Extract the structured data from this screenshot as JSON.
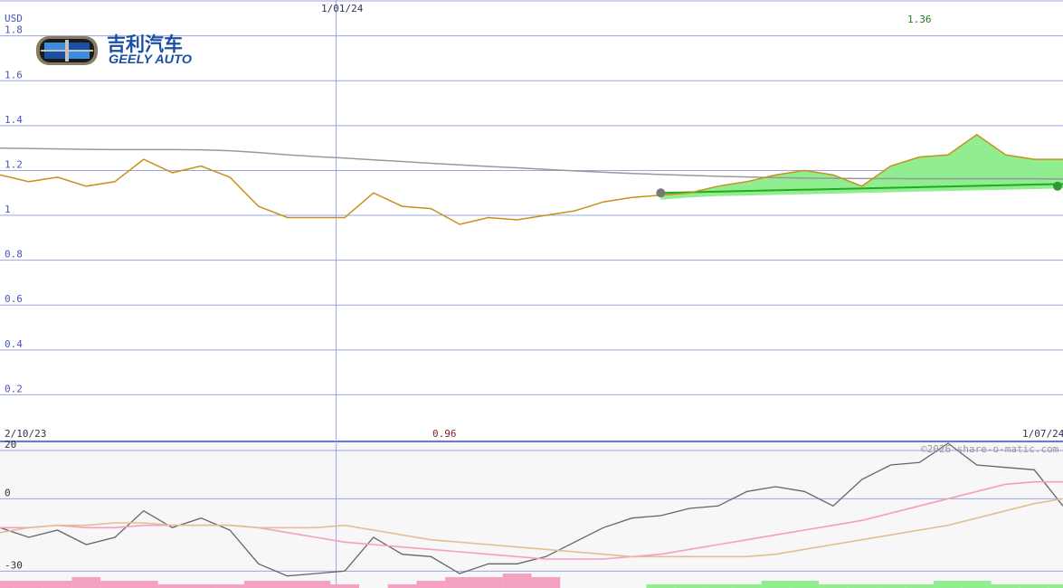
{
  "logo": {
    "cn": "吉利汽车",
    "en": "GEELY AUTO"
  },
  "watermark": "©2026 share-o-matic.com",
  "chart_data": [
    {
      "type": "line",
      "title": "",
      "ylabel": "USD",
      "y_ticks": [
        "1.8",
        "1.6",
        "1.4",
        "1.2",
        "1",
        "0.8",
        "0.6",
        "0.4",
        "0.2"
      ],
      "y_tick_values": [
        1.8,
        1.6,
        1.4,
        1.2,
        1.0,
        0.8,
        0.6,
        0.4,
        0.2
      ],
      "ylim": [
        0.0,
        1.96
      ],
      "x_start_label": "2/10/23",
      "x_end_label": "1/07/24",
      "x_marker_label": "1/01/24",
      "max_label": "1.36",
      "min_label": "0.96",
      "grid": true,
      "x_index": [
        0,
        1,
        2,
        3,
        4,
        5,
        6,
        7,
        8,
        9,
        10,
        11,
        12,
        13,
        14,
        15,
        16,
        17,
        18,
        19,
        20,
        21,
        22,
        23,
        24,
        25,
        26,
        27,
        28,
        29,
        30,
        31,
        32,
        33,
        34,
        35,
        36,
        37
      ],
      "series": [
        {
          "role": "price",
          "color": "#c8901a",
          "values": [
            1.18,
            1.15,
            1.17,
            1.13,
            1.15,
            1.25,
            1.19,
            1.22,
            1.17,
            1.04,
            0.99,
            0.99,
            0.99,
            1.1,
            1.04,
            1.03,
            0.96,
            0.99,
            0.98,
            1.0,
            1.02,
            1.06,
            1.08,
            1.09,
            1.1,
            1.13,
            1.15,
            1.18,
            1.2,
            1.18,
            1.13,
            1.22,
            1.26,
            1.27,
            1.36,
            1.27,
            1.25,
            1.25
          ]
        },
        {
          "role": "moving-average",
          "color": "#999999",
          "values": [
            1.3,
            1.298,
            1.296,
            1.294,
            1.293,
            1.293,
            1.293,
            1.292,
            1.288,
            1.28,
            1.27,
            1.262,
            1.255,
            1.247,
            1.24,
            1.232,
            1.225,
            1.218,
            1.212,
            1.205,
            1.198,
            1.192,
            1.187,
            1.182,
            1.178,
            1.174,
            1.171,
            1.168,
            1.166,
            1.165,
            1.164,
            1.164,
            1.163,
            1.163,
            1.163,
            1.163,
            1.163,
            1.162
          ]
        }
      ],
      "trend_band": {
        "color": "#90ee90",
        "start_index": 23,
        "start_value": 1.1,
        "end_value": 1.14,
        "last_value": 1.13
      }
    },
    {
      "type": "line",
      "title": "",
      "y_ticks": [
        "20",
        "0",
        "-30"
      ],
      "y_tick_values": [
        20,
        0,
        -30
      ],
      "ylim": [
        -37,
        23
      ],
      "grid": true,
      "series": [
        {
          "role": "oscillator",
          "color": "#666666",
          "values": [
            -12,
            -16,
            -13,
            -19,
            -16,
            -5,
            -12,
            -8,
            -13,
            -27,
            -32,
            -31,
            -30,
            -16,
            -23,
            -24,
            -31,
            -27,
            -27,
            -24,
            -18,
            -12,
            -8,
            -7,
            -4,
            -3,
            3,
            5,
            3,
            -3,
            8,
            14,
            15,
            23,
            14,
            13,
            12,
            -3
          ]
        },
        {
          "role": "fast-average",
          "color": "#f4a0b8",
          "values": [
            -12,
            -12,
            -11,
            -12,
            -12,
            -11,
            -11,
            -11,
            -11,
            -12,
            -14,
            -16,
            -18,
            -19,
            -20,
            -21,
            -22,
            -23,
            -24,
            -25,
            -25,
            -25,
            -24,
            -23,
            -21,
            -19,
            -17,
            -15,
            -13,
            -11,
            -9,
            -6,
            -3,
            0,
            3,
            6,
            7,
            7
          ]
        },
        {
          "role": "slow-average",
          "color": "#e0c090",
          "values": [
            -14,
            -12,
            -11,
            -11,
            -10,
            -10,
            -11,
            -11,
            -11,
            -12,
            -12,
            -12,
            -11,
            -13,
            -15,
            -17,
            -18,
            -19,
            -20,
            -21,
            -22,
            -23,
            -24,
            -24,
            -24,
            -24,
            -24,
            -23,
            -21,
            -19,
            -17,
            -15,
            -13,
            -11,
            -8,
            -5,
            -2,
            0
          ]
        }
      ],
      "histogram": {
        "negative_color": "#f4a0c0",
        "positive_color": "#90ee90",
        "values": [
          -2,
          -2,
          -2,
          -3,
          -2,
          -2,
          -1,
          -1,
          -1,
          -2,
          -2,
          -2,
          -1,
          0,
          -1,
          -2,
          -3,
          -3,
          -4,
          -3,
          0,
          0,
          0,
          -1,
          -1,
          -1,
          -1,
          -2,
          -2,
          -1,
          -1,
          -1,
          -1,
          -2,
          -2,
          -1,
          -1,
          -1
        ]
      }
    }
  ]
}
